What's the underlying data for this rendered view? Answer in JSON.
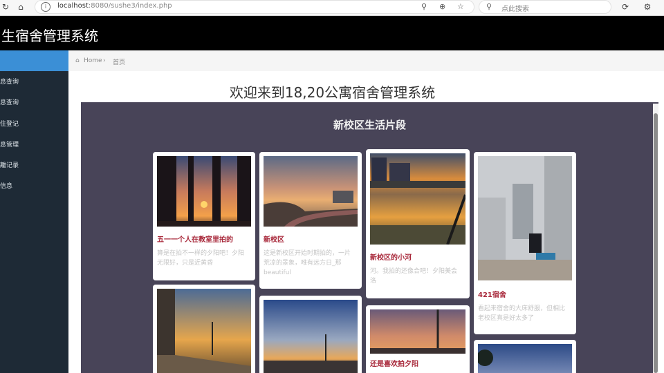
{
  "browser": {
    "url_host": "localhost",
    "url_rest": ":8080/sushe3/index.php",
    "search_placeholder": "点此搜索"
  },
  "app": {
    "title": "生宿舍管理系统"
  },
  "sidebar": {
    "items": [
      {
        "label": "息查询"
      },
      {
        "label": "息查询"
      },
      {
        "label": "住登记"
      },
      {
        "label": "息管理"
      },
      {
        "label": "離记录"
      },
      {
        "label": "信息"
      }
    ]
  },
  "breadcrumb": {
    "home": "Home",
    "separator": "›",
    "current": "首页"
  },
  "main": {
    "heading": "欢迎来到18,20公寓宿舍管理系统",
    "section_title": "新校区生活片段",
    "cards": [
      {
        "title": "五一一个人在教室里拍的",
        "desc": "算是在拍不一样的夕阳吧！夕阳无限好，只是近黄昏"
      },
      {
        "title": "新校区",
        "desc": "这是新校区开始时期拍的，一片荒凉的景象，唯有远方日_那beautiful"
      },
      {
        "title": "新校区的小河",
        "desc": "河。我拍的还像合吧！夕阳美会洛"
      },
      {
        "title": "421宿舍",
        "desc": "看起来宿舍的大床舒服，但相比老校区真是好太多了"
      },
      {
        "title": "",
        "desc": ""
      },
      {
        "title": "",
        "desc": ""
      },
      {
        "title": "还是喜欢拍夕阳",
        "desc": ""
      },
      {
        "title": "",
        "desc": ""
      }
    ]
  }
}
